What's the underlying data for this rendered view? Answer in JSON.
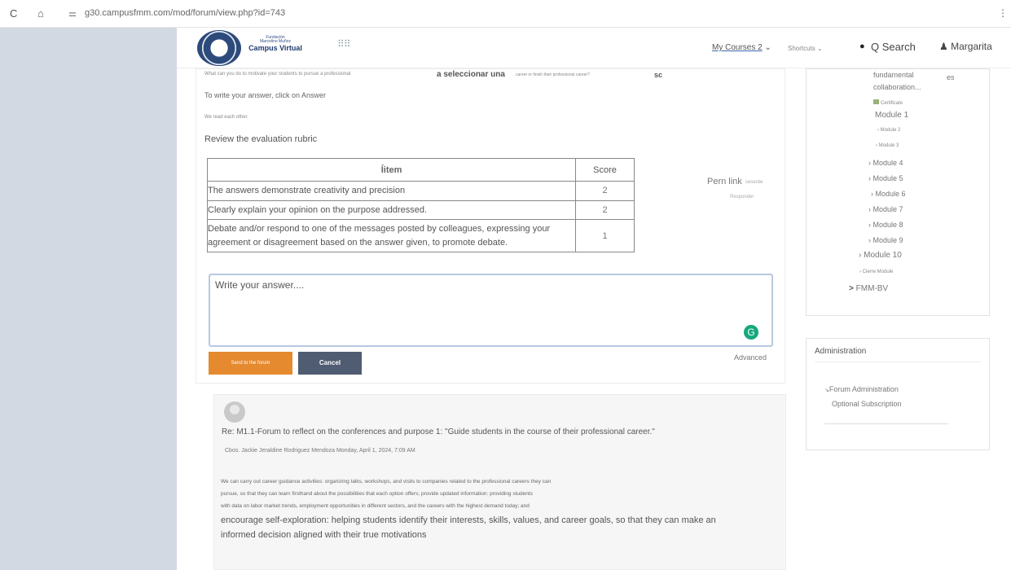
{
  "browser": {
    "reload_icon": "C",
    "home_icon": "⌂",
    "site_info_icon": "⚌",
    "url": "g30.campusfmm.com/mod/forum/view.php?id=743",
    "menu_icon": "⋮"
  },
  "header": {
    "logo_line1": "Fundación",
    "logo_line2": "Marcelino Muñoz",
    "logo_line3": "Campus Virtual",
    "apps_icon": "⠿⠿",
    "my_courses": "My Courses 2",
    "shortcuts": "Shortcuts",
    "search_label": "Q Search",
    "user_name": "Margarita",
    "chat_icon": "●",
    "user_icon": "♟"
  },
  "question": {
    "line_small": "What can you do to motivate your students to pursue a professional",
    "line_bold": "a seleccionar una",
    "line_tail": "career or finish their professional career?",
    "line_sc": "sc",
    "instruction": "To write your answer, click on Answer",
    "we_read": "We read each other.",
    "review": "Review the evaluation rubric"
  },
  "rubric": {
    "col_item": "item",
    "col_item_prefix": "Í",
    "col_score": "Score",
    "rows": [
      {
        "item": "The answers demonstrate creativity and precision",
        "score": "2"
      },
      {
        "item": "Clearly explain your opinion on the purpose addressed.",
        "score": "2"
      },
      {
        "item": "Debate and/or respond to one of the messages posted by colleagues, expressing your agreement or disagreement based on the answer given, to promote debate.",
        "score": "1"
      }
    ]
  },
  "side_links": {
    "perm_link": "Pern link",
    "perm_sub": "ceserde",
    "reply": "Responder"
  },
  "editor": {
    "placeholder": "Write your answer....",
    "send_label": "Send to the forum",
    "cancel_label": "Cancel",
    "advanced_label": "Advanced",
    "grammar_icon": "G"
  },
  "post": {
    "title": "Re: M1.1-Forum to reflect on the conferences and purpose 1: \"Guide students in the course of their professional career.\"",
    "meta": "Cbos. Jackie Jeraldine Rodriguez Mendoza Monday, April 1, 2024, 7:09 AM",
    "lines_small": [
      "We can carry out career guidance activities: organizing talks, workshops, and visits to companies related to the professional careers they can",
      "pursue, so that they can learn firsthand about the possibilities that each option offers; provide updated information: providing students",
      "with data on labor market trends, employment opportunities in different sectors, and the careers with the highest demand today; and"
    ],
    "lines_big": [
      "encourage self-exploration: helping students identify their interests, skills, values, and career goals, so that they can make an",
      "informed decision aligned with their true motivations"
    ]
  },
  "nav": {
    "fundamental": "fundamental",
    "es": "es",
    "collaboration": "collaboration...",
    "certificate": "Certificate",
    "module1": "Module 1",
    "module2": "› Module 2",
    "module3": "› Module 3",
    "module4": "› Module 4",
    "module5": "› Module 5",
    "module6": "› Module 6",
    "module7": "› Module 7",
    "module8": "› Module 8",
    "module9": "› Module 9",
    "module10": "› Module 10",
    "cierre": "› Cierre Module",
    "fmmbv": "FMM-BV"
  },
  "admin": {
    "title": "Administration",
    "forum_admin": "Forum Administration",
    "subscription": "Optional Subscription"
  },
  "colors": {
    "send_button": "#e58a2e",
    "cancel_button": "#4f5c72",
    "left_gutter": "#d3d9e3",
    "grammar_badge": "#15a77d"
  }
}
